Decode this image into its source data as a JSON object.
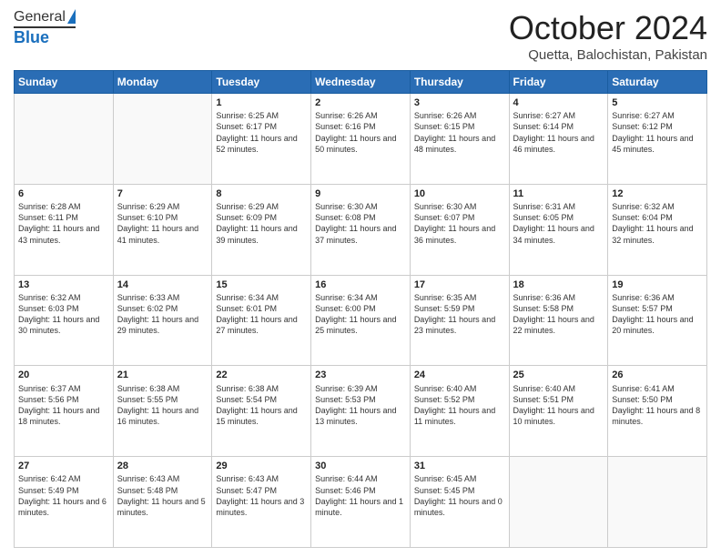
{
  "header": {
    "logo_general": "General",
    "logo_blue": "Blue",
    "title": "October 2024",
    "location": "Quetta, Balochistan, Pakistan"
  },
  "days_of_week": [
    "Sunday",
    "Monday",
    "Tuesday",
    "Wednesday",
    "Thursday",
    "Friday",
    "Saturday"
  ],
  "weeks": [
    [
      {
        "day": "",
        "sunrise": "",
        "sunset": "",
        "daylight": ""
      },
      {
        "day": "",
        "sunrise": "",
        "sunset": "",
        "daylight": ""
      },
      {
        "day": "1",
        "sunrise": "Sunrise: 6:25 AM",
        "sunset": "Sunset: 6:17 PM",
        "daylight": "Daylight: 11 hours and 52 minutes."
      },
      {
        "day": "2",
        "sunrise": "Sunrise: 6:26 AM",
        "sunset": "Sunset: 6:16 PM",
        "daylight": "Daylight: 11 hours and 50 minutes."
      },
      {
        "day": "3",
        "sunrise": "Sunrise: 6:26 AM",
        "sunset": "Sunset: 6:15 PM",
        "daylight": "Daylight: 11 hours and 48 minutes."
      },
      {
        "day": "4",
        "sunrise": "Sunrise: 6:27 AM",
        "sunset": "Sunset: 6:14 PM",
        "daylight": "Daylight: 11 hours and 46 minutes."
      },
      {
        "day": "5",
        "sunrise": "Sunrise: 6:27 AM",
        "sunset": "Sunset: 6:12 PM",
        "daylight": "Daylight: 11 hours and 45 minutes."
      }
    ],
    [
      {
        "day": "6",
        "sunrise": "Sunrise: 6:28 AM",
        "sunset": "Sunset: 6:11 PM",
        "daylight": "Daylight: 11 hours and 43 minutes."
      },
      {
        "day": "7",
        "sunrise": "Sunrise: 6:29 AM",
        "sunset": "Sunset: 6:10 PM",
        "daylight": "Daylight: 11 hours and 41 minutes."
      },
      {
        "day": "8",
        "sunrise": "Sunrise: 6:29 AM",
        "sunset": "Sunset: 6:09 PM",
        "daylight": "Daylight: 11 hours and 39 minutes."
      },
      {
        "day": "9",
        "sunrise": "Sunrise: 6:30 AM",
        "sunset": "Sunset: 6:08 PM",
        "daylight": "Daylight: 11 hours and 37 minutes."
      },
      {
        "day": "10",
        "sunrise": "Sunrise: 6:30 AM",
        "sunset": "Sunset: 6:07 PM",
        "daylight": "Daylight: 11 hours and 36 minutes."
      },
      {
        "day": "11",
        "sunrise": "Sunrise: 6:31 AM",
        "sunset": "Sunset: 6:05 PM",
        "daylight": "Daylight: 11 hours and 34 minutes."
      },
      {
        "day": "12",
        "sunrise": "Sunrise: 6:32 AM",
        "sunset": "Sunset: 6:04 PM",
        "daylight": "Daylight: 11 hours and 32 minutes."
      }
    ],
    [
      {
        "day": "13",
        "sunrise": "Sunrise: 6:32 AM",
        "sunset": "Sunset: 6:03 PM",
        "daylight": "Daylight: 11 hours and 30 minutes."
      },
      {
        "day": "14",
        "sunrise": "Sunrise: 6:33 AM",
        "sunset": "Sunset: 6:02 PM",
        "daylight": "Daylight: 11 hours and 29 minutes."
      },
      {
        "day": "15",
        "sunrise": "Sunrise: 6:34 AM",
        "sunset": "Sunset: 6:01 PM",
        "daylight": "Daylight: 11 hours and 27 minutes."
      },
      {
        "day": "16",
        "sunrise": "Sunrise: 6:34 AM",
        "sunset": "Sunset: 6:00 PM",
        "daylight": "Daylight: 11 hours and 25 minutes."
      },
      {
        "day": "17",
        "sunrise": "Sunrise: 6:35 AM",
        "sunset": "Sunset: 5:59 PM",
        "daylight": "Daylight: 11 hours and 23 minutes."
      },
      {
        "day": "18",
        "sunrise": "Sunrise: 6:36 AM",
        "sunset": "Sunset: 5:58 PM",
        "daylight": "Daylight: 11 hours and 22 minutes."
      },
      {
        "day": "19",
        "sunrise": "Sunrise: 6:36 AM",
        "sunset": "Sunset: 5:57 PM",
        "daylight": "Daylight: 11 hours and 20 minutes."
      }
    ],
    [
      {
        "day": "20",
        "sunrise": "Sunrise: 6:37 AM",
        "sunset": "Sunset: 5:56 PM",
        "daylight": "Daylight: 11 hours and 18 minutes."
      },
      {
        "day": "21",
        "sunrise": "Sunrise: 6:38 AM",
        "sunset": "Sunset: 5:55 PM",
        "daylight": "Daylight: 11 hours and 16 minutes."
      },
      {
        "day": "22",
        "sunrise": "Sunrise: 6:38 AM",
        "sunset": "Sunset: 5:54 PM",
        "daylight": "Daylight: 11 hours and 15 minutes."
      },
      {
        "day": "23",
        "sunrise": "Sunrise: 6:39 AM",
        "sunset": "Sunset: 5:53 PM",
        "daylight": "Daylight: 11 hours and 13 minutes."
      },
      {
        "day": "24",
        "sunrise": "Sunrise: 6:40 AM",
        "sunset": "Sunset: 5:52 PM",
        "daylight": "Daylight: 11 hours and 11 minutes."
      },
      {
        "day": "25",
        "sunrise": "Sunrise: 6:40 AM",
        "sunset": "Sunset: 5:51 PM",
        "daylight": "Daylight: 11 hours and 10 minutes."
      },
      {
        "day": "26",
        "sunrise": "Sunrise: 6:41 AM",
        "sunset": "Sunset: 5:50 PM",
        "daylight": "Daylight: 11 hours and 8 minutes."
      }
    ],
    [
      {
        "day": "27",
        "sunrise": "Sunrise: 6:42 AM",
        "sunset": "Sunset: 5:49 PM",
        "daylight": "Daylight: 11 hours and 6 minutes."
      },
      {
        "day": "28",
        "sunrise": "Sunrise: 6:43 AM",
        "sunset": "Sunset: 5:48 PM",
        "daylight": "Daylight: 11 hours and 5 minutes."
      },
      {
        "day": "29",
        "sunrise": "Sunrise: 6:43 AM",
        "sunset": "Sunset: 5:47 PM",
        "daylight": "Daylight: 11 hours and 3 minutes."
      },
      {
        "day": "30",
        "sunrise": "Sunrise: 6:44 AM",
        "sunset": "Sunset: 5:46 PM",
        "daylight": "Daylight: 11 hours and 1 minute."
      },
      {
        "day": "31",
        "sunrise": "Sunrise: 6:45 AM",
        "sunset": "Sunset: 5:45 PM",
        "daylight": "Daylight: 11 hours and 0 minutes."
      },
      {
        "day": "",
        "sunrise": "",
        "sunset": "",
        "daylight": ""
      },
      {
        "day": "",
        "sunrise": "",
        "sunset": "",
        "daylight": ""
      }
    ]
  ]
}
